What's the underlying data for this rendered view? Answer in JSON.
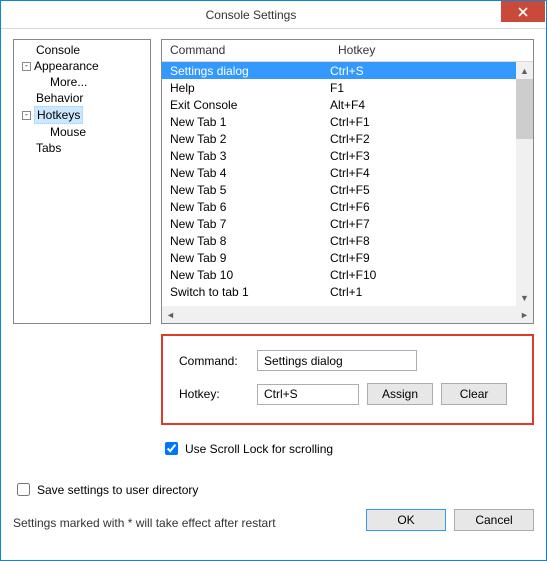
{
  "dialog": {
    "title": "Console Settings"
  },
  "tree": {
    "items": [
      {
        "label": "Console"
      },
      {
        "label": "Appearance",
        "expanded": true,
        "children": [
          {
            "label": "More..."
          }
        ]
      },
      {
        "label": "Behavior"
      },
      {
        "label": "Hotkeys",
        "expanded": true,
        "selected": true,
        "children": [
          {
            "label": "Mouse"
          }
        ]
      },
      {
        "label": "Tabs"
      }
    ]
  },
  "list": {
    "headers": {
      "command": "Command",
      "hotkey": "Hotkey"
    },
    "rows": [
      {
        "command": "Settings dialog",
        "hotkey": "Ctrl+S",
        "selected": true
      },
      {
        "command": "Help",
        "hotkey": "F1"
      },
      {
        "command": "Exit Console",
        "hotkey": "Alt+F4"
      },
      {
        "command": "New Tab 1",
        "hotkey": "Ctrl+F1"
      },
      {
        "command": "New Tab 2",
        "hotkey": "Ctrl+F2"
      },
      {
        "command": "New Tab 3",
        "hotkey": "Ctrl+F3"
      },
      {
        "command": "New Tab 4",
        "hotkey": "Ctrl+F4"
      },
      {
        "command": "New Tab 5",
        "hotkey": "Ctrl+F5"
      },
      {
        "command": "New Tab 6",
        "hotkey": "Ctrl+F6"
      },
      {
        "command": "New Tab 7",
        "hotkey": "Ctrl+F7"
      },
      {
        "command": "New Tab 8",
        "hotkey": "Ctrl+F8"
      },
      {
        "command": "New Tab 9",
        "hotkey": "Ctrl+F9"
      },
      {
        "command": "New Tab 10",
        "hotkey": "Ctrl+F10"
      },
      {
        "command": "Switch to tab 1",
        "hotkey": "Ctrl+1"
      }
    ]
  },
  "editor": {
    "command_label": "Command:",
    "command_value": "Settings dialog",
    "hotkey_label": "Hotkey:",
    "hotkey_value": "Ctrl+S",
    "assign_label": "Assign",
    "clear_label": "Clear"
  },
  "options": {
    "scrolllock_checked": true,
    "scrolllock_label": "Use Scroll Lock for scrolling",
    "save_user_dir_checked": false,
    "save_user_dir_label": "Save settings to user directory"
  },
  "footer": {
    "note": "Settings marked with * will take effect after restart",
    "ok": "OK",
    "cancel": "Cancel"
  }
}
